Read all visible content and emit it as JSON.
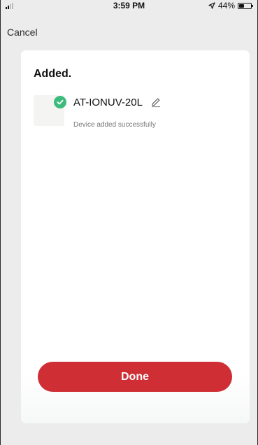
{
  "status_bar": {
    "time": "3:59 PM",
    "battery_percent": "44%",
    "battery_level": 0.44,
    "location_icon": "location-arrow-icon",
    "battery_icon": "battery-icon",
    "signal_icon": "cell-signal-icon"
  },
  "nav": {
    "cancel_label": "Cancel"
  },
  "card": {
    "title": "Added.",
    "device": {
      "name": "AT-IONUV-20L",
      "status": "Device added successfully",
      "check_icon": "check-circle-icon",
      "edit_icon": "pencil-icon"
    },
    "done_label": "Done"
  },
  "colors": {
    "accent": "#cf2e35",
    "success": "#3dbb7d",
    "background": "#ececec",
    "card": "#ffffff"
  }
}
